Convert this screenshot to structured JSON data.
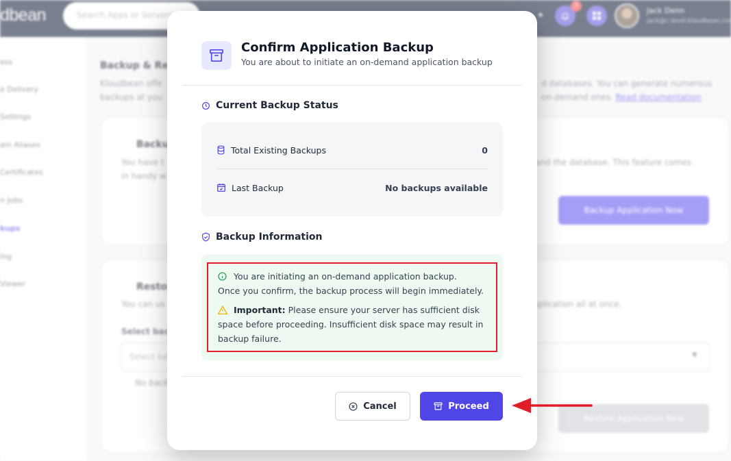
{
  "topbar": {
    "logo": "dbean",
    "search_placeholder": "Search Apps or Servers",
    "notification_count": "7",
    "user_name": "Jack Denn",
    "user_email": "jack@c-level.kloudbean.com"
  },
  "sidebar": {
    "items": [
      {
        "label": "ess"
      },
      {
        "label": "e Delivery"
      },
      {
        "label": "Settings"
      },
      {
        "label": "ain Aliases"
      },
      {
        "label": "Certificates"
      },
      {
        "label": "n Jobs"
      },
      {
        "label": "kups"
      },
      {
        "label": "ing"
      },
      {
        "label": "Viewer"
      }
    ]
  },
  "page": {
    "title": "Backup & Res",
    "desc_line1": "Kloudbean offe",
    "desc_line2": "backups at you",
    "desc_right1": "d databases. You can generate numerous",
    "desc_right2": "on-demand ones.",
    "doc_link": "Read documentation",
    "card1_title": "Backup",
    "card1_text1": "You have t",
    "card1_text2": "in handy w",
    "card1_right": "s and the database. This feature comes",
    "card1_button": "Backup Application Now",
    "card2_title": "Restor",
    "card2_text1": "You can us",
    "card2_right": "application all at once.",
    "card2_select_label": "Select back",
    "card2_select_placeholder": "Select ba",
    "card2_note": "No back",
    "card2_button": "Restore Application Now"
  },
  "modal": {
    "title": "Confirm Application Backup",
    "subtitle": "You are about to initiate an on-demand application backup",
    "status_section_title": "Current Backup Status",
    "total_label": "Total Existing Backups",
    "total_value": "0",
    "last_label": "Last Backup",
    "last_value": "No backups available",
    "info_section_title": "Backup Information",
    "info_line1": "You are initiating an on-demand application backup.",
    "info_line2": "Once you confirm, the backup process will begin immediately.",
    "important_label": "Important:",
    "important_line1": "Please ensure your server has sufficient disk",
    "important_line2": "space before proceeding. Insufficient disk space may result in",
    "important_line3": "backup failure.",
    "cancel_label": "Cancel",
    "proceed_label": "Proceed"
  },
  "colors": {
    "primary": "#4f46e5",
    "topbar": "#0b1833",
    "highlight_border": "#e11d2a",
    "info_bg": "#eefaf1"
  }
}
